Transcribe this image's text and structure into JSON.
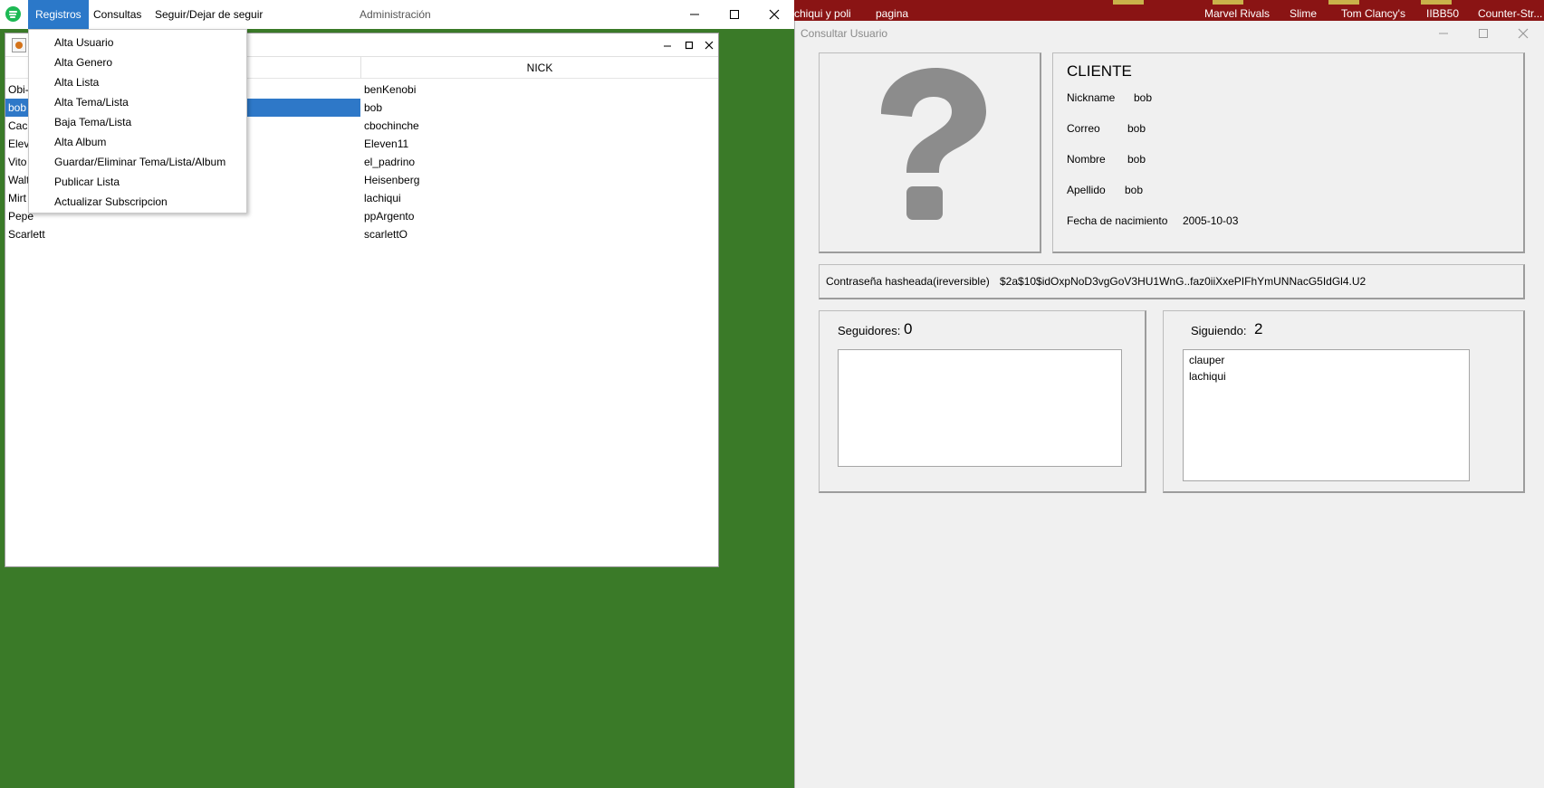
{
  "desktop": {
    "items": [
      "chiqui y poli",
      "pagina",
      "Marvel Rivals",
      "Slime",
      "Tom Clancy's",
      "IIBB50",
      "Counter-Str..."
    ]
  },
  "main_window": {
    "title": "Administración",
    "menus": [
      "Registros",
      "Consultas",
      "Seguir/Dejar de seguir"
    ],
    "inner_table": {
      "columns": [
        "",
        "NICK"
      ],
      "rows": [
        {
          "name": "Obi-",
          "nick": "benKenobi"
        },
        {
          "name": "bob",
          "nick": "bob"
        },
        {
          "name": "Cacl",
          "nick": "cbochinche"
        },
        {
          "name": "Elev",
          "nick": "Eleven11"
        },
        {
          "name": "Vito",
          "nick": "el_padrino"
        },
        {
          "name": "Walt",
          "nick": "Heisenberg"
        },
        {
          "name": "Mirt",
          "nick": "lachiqui"
        },
        {
          "name": "Pepe",
          "nick": "ppArgento"
        },
        {
          "name": "Scarlett",
          "nick": "scarlettO"
        }
      ],
      "selected_row": 1
    }
  },
  "dropdown": {
    "items": [
      "Alta Usuario",
      "Alta Genero",
      "Alta Lista",
      "Alta Tema/Lista",
      "Baja Tema/Lista",
      "Alta Album",
      "Guardar/Eliminar Tema/Lista/Album",
      "Publicar Lista",
      "Actualizar Subscripcion"
    ]
  },
  "consult": {
    "title": "Consultar Usuario",
    "avatar_glyph": "?",
    "user_type": "CLIENTE",
    "fields": [
      {
        "label": "Nickname",
        "value": "bob"
      },
      {
        "label": "Correo",
        "value": "bob"
      },
      {
        "label": "Nombre",
        "value": "bob"
      },
      {
        "label": "Apellido",
        "value": "bob"
      },
      {
        "label": "Fecha de nacimiento",
        "value": "2005-10-03"
      }
    ],
    "password": {
      "label": "Contraseña hasheada(ireversible)",
      "value": "$2a$10$idOxpNoD3vgGoV3HU1WnG..faz0iiXxePIFhYmUNNacG5IdGl4.U2"
    },
    "seguidores": {
      "label": "Seguidores:",
      "count": "0",
      "items": []
    },
    "siguiendo": {
      "label": "Siguiendo:",
      "count": "2",
      "items": [
        "clauper",
        "lachiqui"
      ]
    }
  },
  "colors": {
    "desktop_green": "#3a7a28",
    "menu_active": "#2b78c9",
    "selection": "#2e78c8",
    "spotify_green": "#1db954",
    "avatar_gray": "#8c8c8c"
  }
}
